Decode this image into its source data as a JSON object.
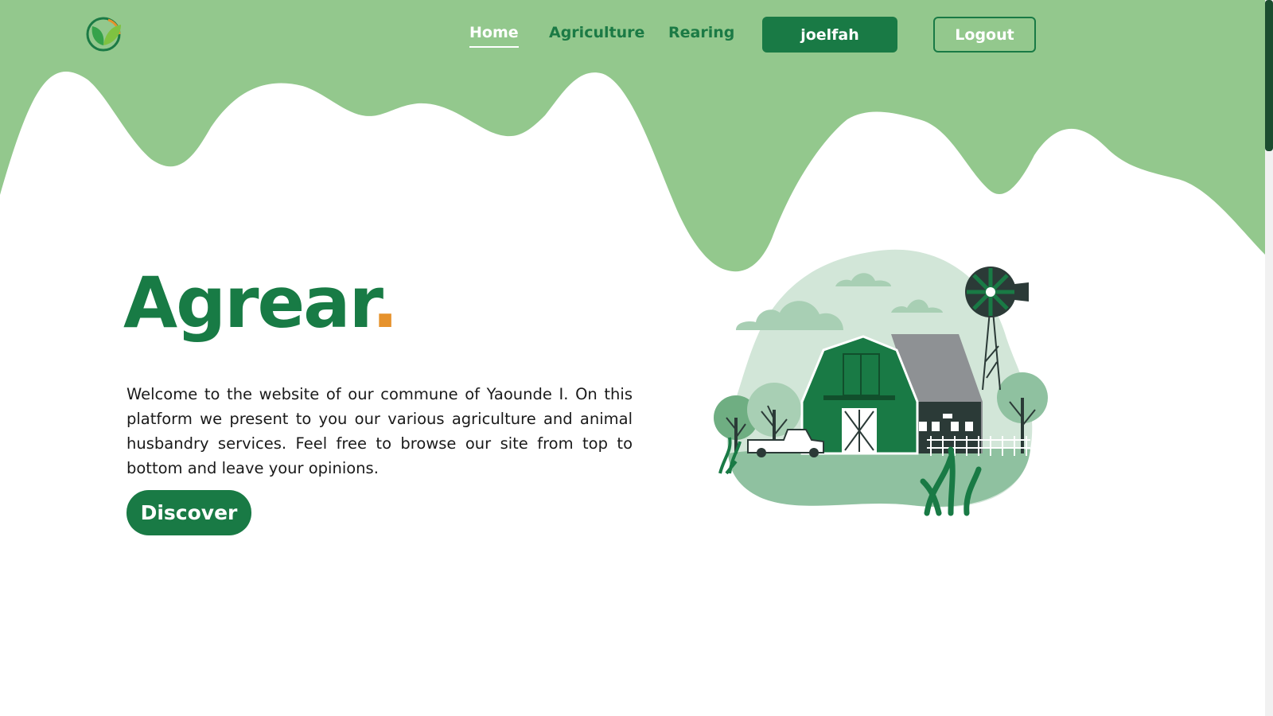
{
  "nav": {
    "logo_icon": "leaf-logo-icon",
    "links": [
      {
        "label": "Home",
        "active": true
      },
      {
        "label": "Agriculture",
        "active": false
      },
      {
        "label": "Rearing",
        "active": false
      }
    ],
    "user_label": "joelfah",
    "logout_label": "Logout"
  },
  "hero": {
    "title": "Agrear",
    "title_dot": ".",
    "description": "Welcome to the website of our commune of Yaounde I. On this platform we present to you our various agriculture and animal husbandry services. Feel free to browse our site from top to bottom and leave your opinions.",
    "button_label": "Discover",
    "illustration_icon": "farm-barn-illustration"
  },
  "colors": {
    "primary_green": "#197a45",
    "light_green": "#93c88d",
    "accent_orange": "#e6922c",
    "white": "#ffffff"
  }
}
